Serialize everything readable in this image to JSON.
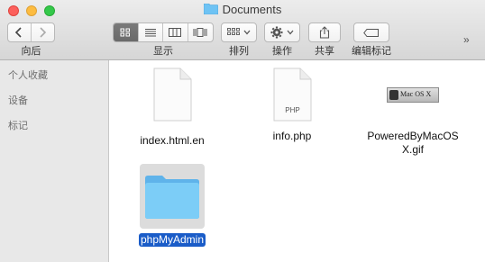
{
  "window": {
    "title": "Documents",
    "folder_color": "#6ec3f4"
  },
  "toolbar": {
    "back_forward_label": "向后",
    "view_label": "显示",
    "arrange_label": "排列",
    "action_label": "操作",
    "share_label": "共享",
    "tags_label": "编辑标记",
    "overflow": "»"
  },
  "sidebar": {
    "items": [
      {
        "label": "个人收藏"
      },
      {
        "label": "设备"
      },
      {
        "label": "标记"
      }
    ]
  },
  "files": [
    {
      "name": "index.html.en",
      "icon": "document-icon"
    },
    {
      "name": "info.php",
      "icon": "php-document-icon",
      "badge": "PHP"
    },
    {
      "name": "PoweredByMacOSX.gif",
      "name_line1": "PoweredByMacOS",
      "name_line2": "X.gif",
      "icon": "image-thumbnail-icon",
      "thumb_text": "Mac OS X"
    },
    {
      "name": "phpMyAdmin",
      "icon": "folder-icon",
      "selected": true
    }
  ],
  "colors": {
    "selection": "#1a5cc8",
    "folder": "#6ec3f4"
  }
}
